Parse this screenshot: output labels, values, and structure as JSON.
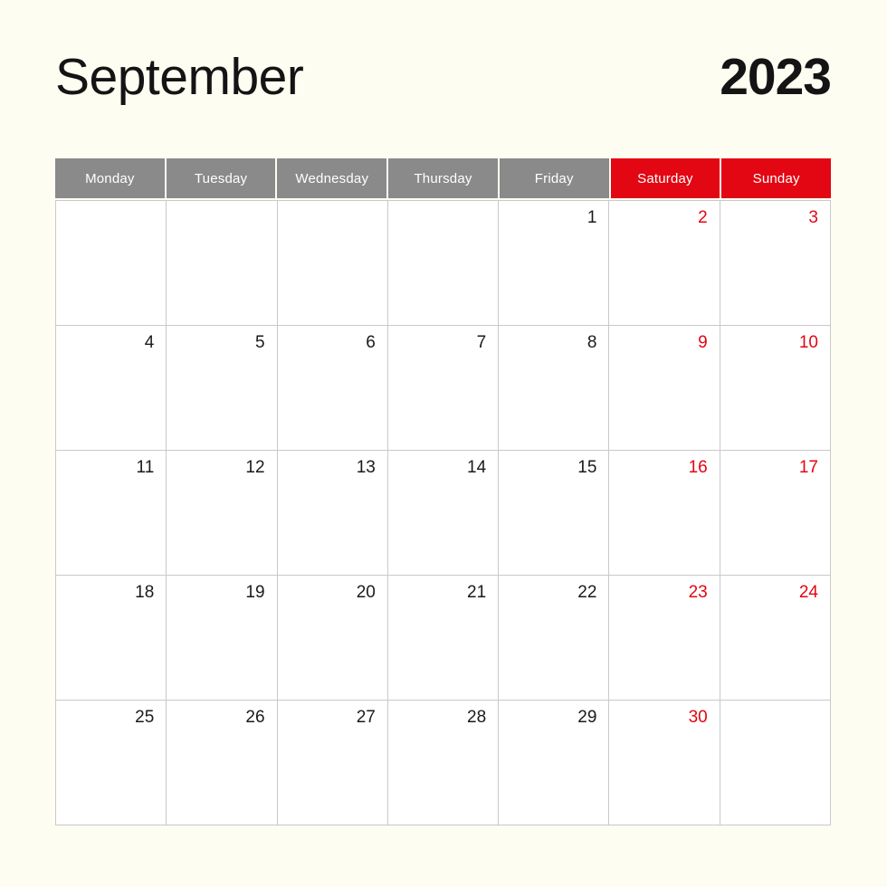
{
  "page": {
    "background_color": "#fdfdf2"
  },
  "header": {
    "month": "September",
    "year": "2023"
  },
  "colors": {
    "weekday_header_bg": "#8a8a8a",
    "weekend_header_bg": "#e30613",
    "weekend_text": "#e30613",
    "weekday_text": "#1a1a1a",
    "grid_line": "#c9c9c9",
    "cell_bg": "#ffffff"
  },
  "weekdays": [
    {
      "label": "Monday",
      "weekend": false
    },
    {
      "label": "Tuesday",
      "weekend": false
    },
    {
      "label": "Wednesday",
      "weekend": false
    },
    {
      "label": "Thursday",
      "weekend": false
    },
    {
      "label": "Friday",
      "weekend": false
    },
    {
      "label": "Saturday",
      "weekend": true
    },
    {
      "label": "Sunday",
      "weekend": true
    }
  ],
  "weeks": [
    [
      {
        "day": "",
        "weekend": false,
        "empty": true
      },
      {
        "day": "",
        "weekend": false,
        "empty": true
      },
      {
        "day": "",
        "weekend": false,
        "empty": true
      },
      {
        "day": "",
        "weekend": false,
        "empty": true
      },
      {
        "day": "1",
        "weekend": false,
        "empty": false
      },
      {
        "day": "2",
        "weekend": true,
        "empty": false
      },
      {
        "day": "3",
        "weekend": true,
        "empty": false
      }
    ],
    [
      {
        "day": "4",
        "weekend": false,
        "empty": false
      },
      {
        "day": "5",
        "weekend": false,
        "empty": false
      },
      {
        "day": "6",
        "weekend": false,
        "empty": false
      },
      {
        "day": "7",
        "weekend": false,
        "empty": false
      },
      {
        "day": "8",
        "weekend": false,
        "empty": false
      },
      {
        "day": "9",
        "weekend": true,
        "empty": false
      },
      {
        "day": "10",
        "weekend": true,
        "empty": false
      }
    ],
    [
      {
        "day": "11",
        "weekend": false,
        "empty": false
      },
      {
        "day": "12",
        "weekend": false,
        "empty": false
      },
      {
        "day": "13",
        "weekend": false,
        "empty": false
      },
      {
        "day": "14",
        "weekend": false,
        "empty": false
      },
      {
        "day": "15",
        "weekend": false,
        "empty": false
      },
      {
        "day": "16",
        "weekend": true,
        "empty": false
      },
      {
        "day": "17",
        "weekend": true,
        "empty": false
      }
    ],
    [
      {
        "day": "18",
        "weekend": false,
        "empty": false
      },
      {
        "day": "19",
        "weekend": false,
        "empty": false
      },
      {
        "day": "20",
        "weekend": false,
        "empty": false
      },
      {
        "day": "21",
        "weekend": false,
        "empty": false
      },
      {
        "day": "22",
        "weekend": false,
        "empty": false
      },
      {
        "day": "23",
        "weekend": true,
        "empty": false
      },
      {
        "day": "24",
        "weekend": true,
        "empty": false
      }
    ],
    [
      {
        "day": "25",
        "weekend": false,
        "empty": false
      },
      {
        "day": "26",
        "weekend": false,
        "empty": false
      },
      {
        "day": "27",
        "weekend": false,
        "empty": false
      },
      {
        "day": "28",
        "weekend": false,
        "empty": false
      },
      {
        "day": "29",
        "weekend": false,
        "empty": false
      },
      {
        "day": "30",
        "weekend": true,
        "empty": false
      },
      {
        "day": "",
        "weekend": true,
        "empty": true
      }
    ]
  ]
}
